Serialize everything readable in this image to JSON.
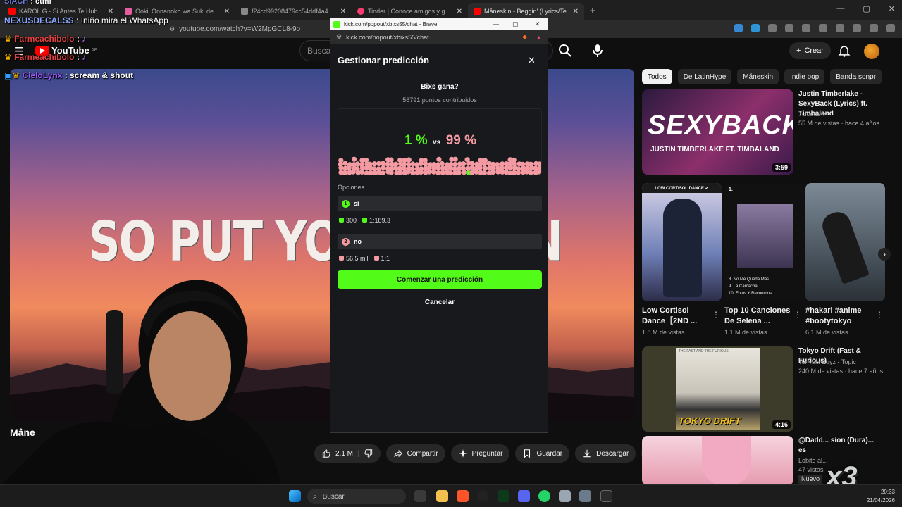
{
  "browser": {
    "tabs": [
      {
        "label": "KAROL G - Si Antes Te Hubiera Cono...",
        "color": "#ff0000"
      },
      {
        "label": "Ookii Onnanoko wa Suki desu ka? C...",
        "color": "#e45da0"
      },
      {
        "label": "f24cd99208479cc54ddf4a4db1c156...",
        "color": "#888888"
      },
      {
        "label": "Tinder | Conoce amigos y gente nue...",
        "color": "#fe3c72"
      },
      {
        "label": "Måneskin - Beggin' (Lyrics/Te",
        "color": "#ff0000",
        "active": true
      }
    ],
    "new_tab": "+",
    "url": "youtube.com/watch?v=W2MpGCL8-9o"
  },
  "youtube": {
    "logo": "YouTube",
    "region": "PE",
    "search_placeholder": "Buscar",
    "create_label": "Crear",
    "video_title_partial": "Mâne",
    "lyric_text": "SO PUT YOUR LOVIN",
    "actions": {
      "likes": "2.1 M",
      "share": "Compartir",
      "ask": "Preguntar",
      "save": "Guardar",
      "download": "Descargar"
    },
    "chips": [
      "Todos",
      "De LatinHype",
      "Måneskin",
      "Indie pop",
      "Banda sonor"
    ],
    "recommended": [
      {
        "title": "Justin Timberlake - SexyBack (Lyrics) ft. Timbaland",
        "channel": "7clouds",
        "meta": "55 M de vistas · hace 4 años",
        "duration": "3:59",
        "thumb_text": "SEXYBACK",
        "thumb_sub": "JUSTIN TIMBERLAKE FT. TIMBALAND"
      },
      {
        "title": "Tokyo Drift (Fast & Furious)",
        "channel": "Teriyaki Boyz - Topic",
        "meta": "240 M de vistas · hace 7 años",
        "duration": "4:16",
        "thumb_text": "TOKYO DRIFT",
        "thumb_sub": "THE FAST AND THE FURIOUS"
      },
      {
        "title": "@Dadd... sion (Dura)... es",
        "channel": "Lobito al...",
        "meta": "47 vistas",
        "badge": "Nuevo"
      }
    ],
    "shorts": [
      {
        "title": "Low Cortisol Dance［2ND ...",
        "meta": "1.8 M de vistas",
        "thumb_text": "LOW CORTISOL DANCE ✔"
      },
      {
        "title": "Top 10 Canciones De Selena ...",
        "meta": "1.1 M de vistas",
        "thumb_lines": [
          "1.",
          "8. No Me Queda Más",
          "9. La Carcacha",
          "10. Fotos Y Recuerdos"
        ]
      },
      {
        "title": "#hakari #anime #bootytokyo",
        "meta": "6.1 M de vistas"
      }
    ]
  },
  "popout": {
    "window_title": "kick.com/popout/xbixs55/chat - Brave",
    "url": "kick.com/popout/xbixs55/chat",
    "modal_title": "Gestionar predicción",
    "question": "Bixs gana?",
    "points": "56791 puntos contribuidos",
    "pct_a": "1 %",
    "vs": "vs",
    "pct_b": "99 %",
    "share_a": 0.01,
    "share_b": 0.99,
    "color_a": "#53fc18",
    "color_b": "#f49aa3",
    "options_label": "Opciones",
    "options": [
      {
        "num": "1",
        "label": "si",
        "users": "300",
        "ratio": "1:189.3",
        "color": "#53fc18"
      },
      {
        "num": "2",
        "label": "no",
        "users": "56,5 mil",
        "ratio": "1:1",
        "color": "#f49aa3"
      }
    ],
    "start_label": "Comenzar una predicción",
    "cancel_label": "Cancelar"
  },
  "chat_overlay": [
    {
      "user": "SIACH",
      "msg": ": ctmr",
      "color": "#6d7ad6"
    },
    {
      "user": "NEXUSDECALSS",
      "msg": ": Iniño mira el WhatsApp",
      "color": "#8aa8ff"
    },
    {
      "user": "Farmeachibolo",
      "msg": ":",
      "color": "#e04040"
    },
    {
      "user": "Farmeachibolo",
      "msg": ":",
      "color": "#e04040"
    },
    {
      "user": "CieloLynx",
      "msg": ": scream & shout",
      "color": "#9b59ff"
    }
  ],
  "taskbar": {
    "search": "Buscar",
    "time": "20:33",
    "date": "21/04/2026"
  },
  "overlay_multiplier": "x3"
}
